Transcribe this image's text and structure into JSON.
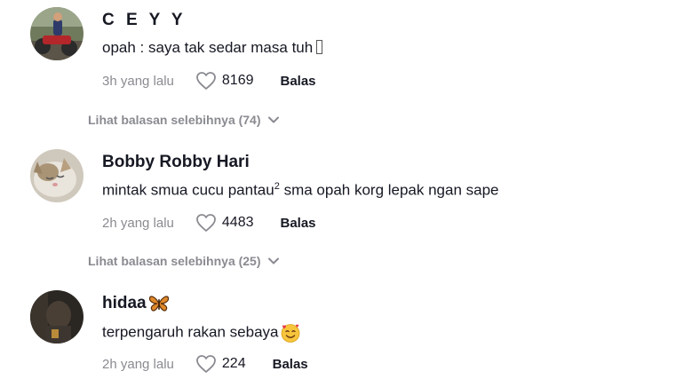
{
  "comments": [
    {
      "username": "C E Y Y",
      "text": "opah : saya tak sedar masa tuh",
      "time": "3h yang lalu",
      "likes": "8169",
      "reply_label": "Balas",
      "more_replies": "Lihat balasan selebihnya (74)"
    },
    {
      "username": "Bobby Robby Hari",
      "text_before": "mintak smua cucu pantau",
      "text_sup": "2",
      "text_after": " sma opah korg lepak ngan sape",
      "time": "2h yang lalu",
      "likes": "4483",
      "reply_label": "Balas",
      "more_replies": "Lihat balasan selebihnya (25)"
    },
    {
      "username": "hidaa",
      "text": "terpengaruh rakan sebaya",
      "time": "2h yang lalu",
      "likes": "224",
      "reply_label": "Balas"
    }
  ],
  "icons": {
    "like": "heart-outline-icon",
    "expand": "chevron-down-icon",
    "emoji_butterfly": "butterfly-emoji-icon",
    "emoji_smile": "smiling-face-with-hearts-emoji-icon"
  },
  "colors": {
    "meta_gray": "#8a8b91",
    "text_dark": "#161823"
  }
}
